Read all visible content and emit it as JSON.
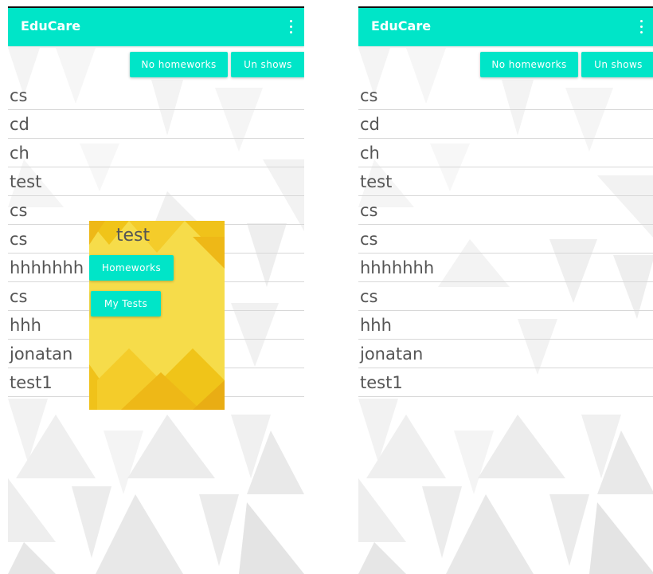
{
  "app": {
    "title": "EduCare",
    "accent_color": "#00e5c8",
    "menu_icon": "kebab-menu-icon"
  },
  "toolbar": {
    "no_homeworks_label": "No homeworks",
    "un_shows_label": "Un shows"
  },
  "list": {
    "items": [
      "cs",
      "cd",
      "ch",
      "test",
      "cs",
      "cs",
      "hhhhhhh",
      "cs",
      "hhh",
      "jonatan",
      "test1"
    ]
  },
  "popup": {
    "title": "test",
    "homeworks_label": "Homeworks",
    "my_tests_label": "My Tests",
    "background_color": "#f6dc4a"
  }
}
